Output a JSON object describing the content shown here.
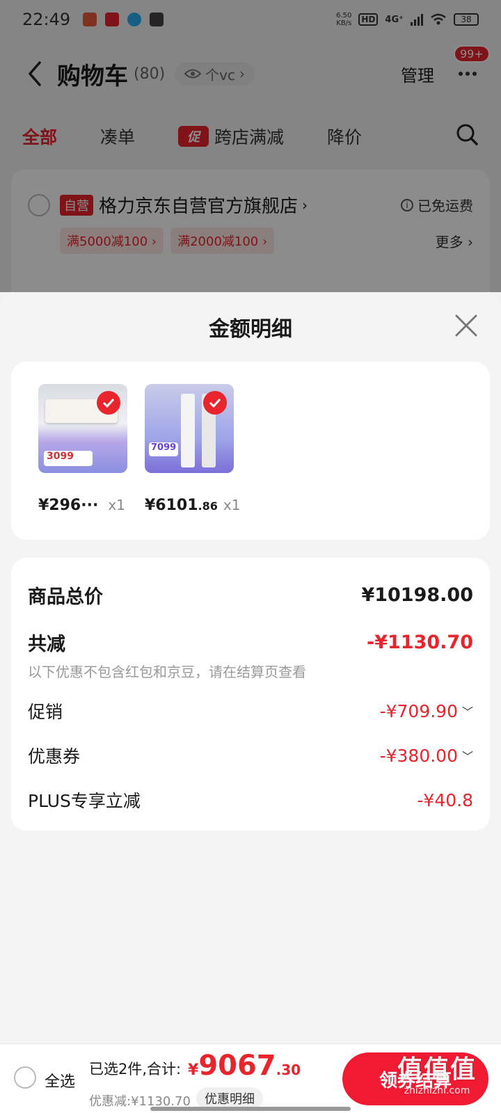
{
  "status_bar": {
    "time": "22:49",
    "net_speed": "6.50",
    "net_unit": "KB/s",
    "hd": "HD",
    "network": "4G⁺",
    "battery": "38"
  },
  "header": {
    "title": "购物车",
    "count": "(80)",
    "vc_label": "个vc",
    "manage_label": "管理",
    "badge": "99+"
  },
  "tabs": [
    {
      "label": "全部"
    },
    {
      "label": "凑单"
    },
    {
      "label": "跨店满减",
      "tag": "促"
    },
    {
      "label": "降价"
    }
  ],
  "store": {
    "self_tag": "自营",
    "name": "格力京东自营官方旗舰店",
    "free_shipping": "已免运费",
    "coupons": [
      "满5000减100 ›",
      "满2000减100 ›"
    ],
    "more": "更多 ›"
  },
  "sheet": {
    "title": "金额明细",
    "products": [
      {
        "price": "¥296···",
        "price_dec": "",
        "qty": "x1",
        "img_tag": "3099"
      },
      {
        "price": "¥6101",
        "price_dec": ".86",
        "qty": "x1",
        "img_tag": "7099"
      }
    ],
    "summary": {
      "total_label": "商品总价",
      "total_value": "¥10198.00",
      "discount_label": "共减",
      "discount_value": "-¥1130.70",
      "discount_note": "以下优惠不包含红包和京豆，请在结算页查看",
      "promo_label": "促销",
      "promo_value": "-¥709.90",
      "coupon_label": "优惠券",
      "coupon_value": "-¥380.00",
      "plus_label": "PLUS专享立减",
      "plus_value": "-¥40.8"
    }
  },
  "bottom_bar": {
    "select_all": "全选",
    "selected_text": "已选2件,合计:",
    "total_currency": "¥",
    "total_int": "9067",
    "total_dec": ".30",
    "saving": "优惠减:¥1130.70",
    "detail_button": "优惠明细",
    "checkout": "领券结算"
  },
  "watermark": {
    "big": "值值值",
    "small": "zhizhizhi.com"
  },
  "colors": {
    "accent": "#e8242c",
    "checkout": "#f01b32"
  }
}
